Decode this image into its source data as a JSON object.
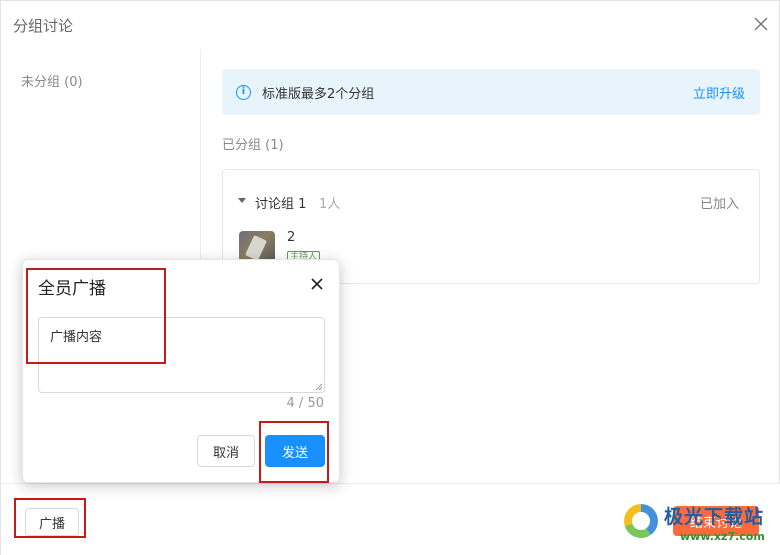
{
  "window": {
    "title": "分组讨论"
  },
  "left_panel": {
    "ungrouped_label": "未分组 (0)"
  },
  "banner": {
    "icon": "info-icon",
    "text": "标准版最多2个分组",
    "upgrade_link": "立即升级"
  },
  "grouped_label": "已分组 (1)",
  "group": {
    "name": "讨论组 1",
    "member_count": "1人",
    "status": "已加入",
    "member": {
      "name": "2",
      "tag": "主持人"
    }
  },
  "footer": {
    "broadcast_button": "广播",
    "end_button": "结束讨论"
  },
  "modal": {
    "title": "全员广播",
    "textarea_value": "广播内容",
    "counter": "4 / 50",
    "cancel_button": "取消",
    "send_button": "发送"
  },
  "watermark": {
    "text": "极光下载站",
    "url": "www.xz7.com"
  },
  "colors": {
    "primary": "#1890ff",
    "danger_orange": "#ff6a3d",
    "banner_bg": "#e8f4fc",
    "highlight_red": "#c41a1a"
  }
}
